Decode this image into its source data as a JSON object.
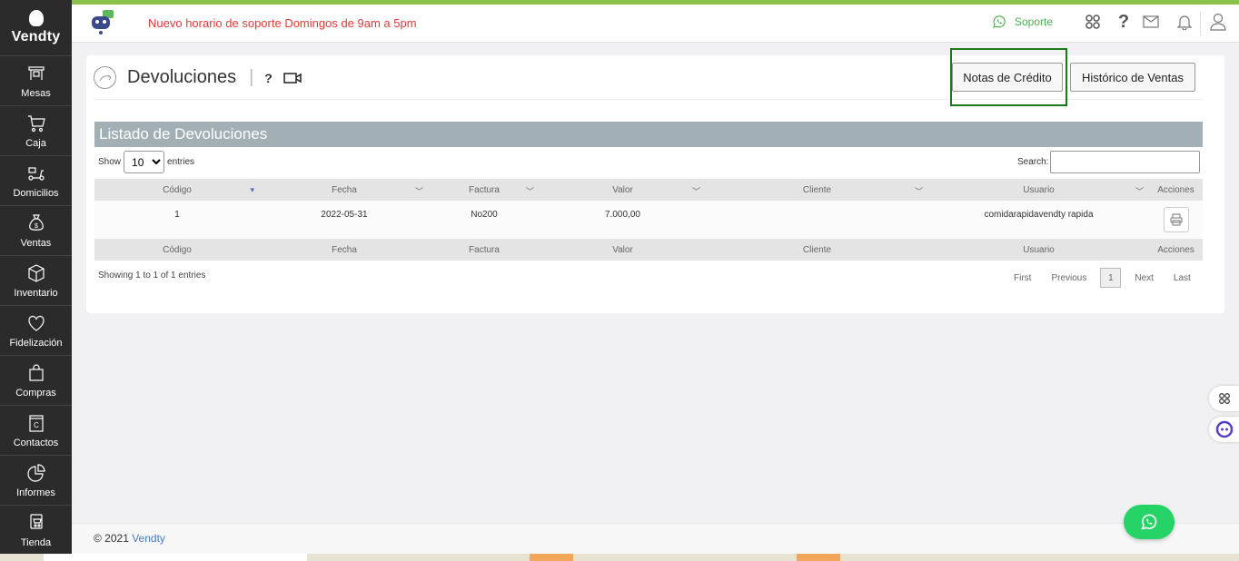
{
  "app": {
    "logo_text": "Vendty"
  },
  "sidebar": {
    "items": [
      {
        "label": "Mesas",
        "icon": "tables-icon"
      },
      {
        "label": "Caja",
        "icon": "cart-icon"
      },
      {
        "label": "Domicilios",
        "icon": "scooter-icon"
      },
      {
        "label": "Ventas",
        "icon": "money-bag-icon"
      },
      {
        "label": "Inventario",
        "icon": "box-icon"
      },
      {
        "label": "Fidelización",
        "icon": "heart-icon"
      },
      {
        "label": "Compras",
        "icon": "shopping-bag-icon"
      },
      {
        "label": "Contactos",
        "icon": "contacts-book-icon"
      },
      {
        "label": "Informes",
        "icon": "pie-chart-icon"
      },
      {
        "label": "Tienda",
        "icon": "store-cart-icon"
      }
    ]
  },
  "header": {
    "announcement": "Nuevo horario de soporte Domingos de 9am a 5pm",
    "support_label": "Soporte",
    "help_label": "?"
  },
  "page": {
    "title": "Devoluciones",
    "separator": "|",
    "help_label": "?",
    "buttons": {
      "credit_notes": "Notas de Crédito",
      "sales_history": "Histórico de Ventas"
    }
  },
  "list": {
    "title": "Listado de Devoluciones",
    "show_label": "Show",
    "entries_label": "entries",
    "page_size": "10",
    "page_size_options": [
      "10"
    ],
    "search_label": "Search:",
    "search_value": "",
    "columns": [
      "Código",
      "Fecha",
      "Factura",
      "Valor",
      "Cliente",
      "Usuario",
      "Acciones"
    ],
    "rows": [
      {
        "codigo": "1",
        "fecha": "2022-05-31",
        "factura": "No200",
        "valor": "7.000,00",
        "cliente": "",
        "usuario": "comidarapidavendty rapida"
      }
    ],
    "info": "Showing 1 to 1 of 1 entries",
    "pager": {
      "first": "First",
      "previous": "Previous",
      "current": "1",
      "next": "Next",
      "last": "Last"
    }
  },
  "footer": {
    "copyright": "© 2021 ",
    "brand": "Vendty"
  },
  "colors": {
    "accent_green": "#1a7a1a",
    "announcement_red": "#e53935",
    "whatsapp": "#25d366",
    "list_header": "#a2b0b6"
  }
}
